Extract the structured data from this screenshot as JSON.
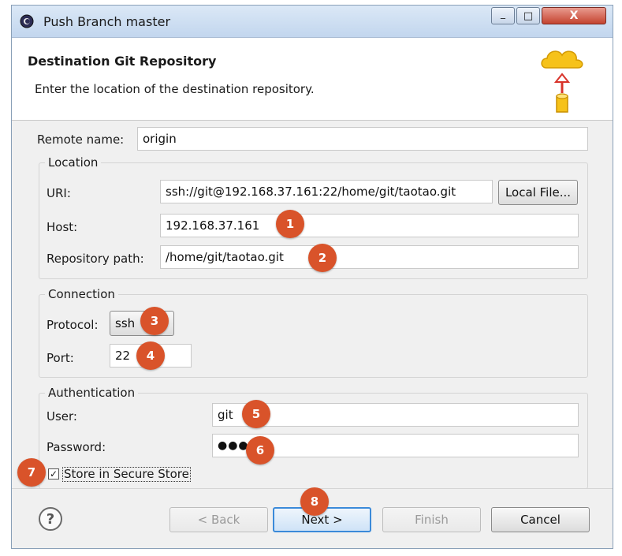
{
  "window": {
    "title": "Push Branch master",
    "close_glyph": "X",
    "min_glyph": "_",
    "max_glyph": "□"
  },
  "header": {
    "title": "Destination Git Repository",
    "description": "Enter the location of the destination repository."
  },
  "remote": {
    "label": "Remote name:",
    "value": "origin"
  },
  "location": {
    "group_title": "Location",
    "uri_label": "URI:",
    "uri_value": "ssh://git@192.168.37.161:22/home/git/taotao.git",
    "local_file_button": "Local File...",
    "host_label": "Host:",
    "host_value": "192.168.37.161",
    "path_label": "Repository path:",
    "path_value": "/home/git/taotao.git"
  },
  "connection": {
    "group_title": "Connection",
    "protocol_label": "Protocol:",
    "protocol_value": "ssh",
    "port_label": "Port:",
    "port_value": "22"
  },
  "authentication": {
    "group_title": "Authentication",
    "user_label": "User:",
    "user_value": "git",
    "password_label": "Password:",
    "password_value": "●●●",
    "store_label": "Store in Secure Store",
    "store_checked": true
  },
  "buttons": {
    "help": "?",
    "back": "< Back",
    "next": "Next >",
    "finish": "Finish",
    "cancel": "Cancel"
  },
  "badges": [
    "1",
    "2",
    "3",
    "4",
    "5",
    "6",
    "7",
    "8"
  ],
  "colors": {
    "badge": "#d9532a",
    "default_button_border": "#3b8ad9"
  }
}
